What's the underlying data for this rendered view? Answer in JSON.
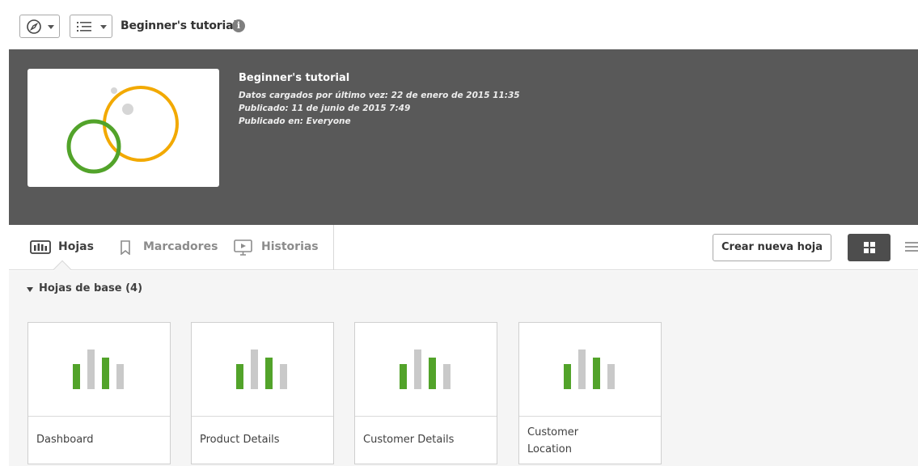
{
  "toolbar": {
    "navigation_icon": "compass-icon",
    "menu_icon": "list-icon",
    "app_title": "Beginner's tutorial",
    "info_glyph": "i"
  },
  "app_header": {
    "title": "Beginner's tutorial",
    "data_loaded": "Datos cargados por último vez: 22 de enero de 2015 11:35",
    "published": "Publicado: 11 de junio de 2015 7:49",
    "published_in": "Publicado en: Everyone",
    "thumbnail_icon": "circles-logo-icon"
  },
  "tabs": [
    {
      "label": "Hojas",
      "icon": "sheet-icon",
      "active": true
    },
    {
      "label": "Marcadores",
      "icon": "bookmark-icon",
      "active": false
    },
    {
      "label": "Historias",
      "icon": "story-icon",
      "active": false
    }
  ],
  "actions": {
    "create_sheet_label": "Crear nueva hoja",
    "grid_view_icon": "grid-view-icon",
    "list_view_icon": "list-view-icon"
  },
  "section": {
    "title": "Hojas de base (4)"
  },
  "sheets": [
    {
      "name": "Dashboard"
    },
    {
      "name": "Product Details"
    },
    {
      "name": "Customer Details"
    },
    {
      "name": "Customer Location"
    }
  ],
  "colors": {
    "header_bg": "#595959",
    "accent_green": "#52a32a",
    "accent_orange": "#f2a900",
    "bar_grey": "#c9c9c9",
    "content_bg": "#f5f5f5"
  }
}
